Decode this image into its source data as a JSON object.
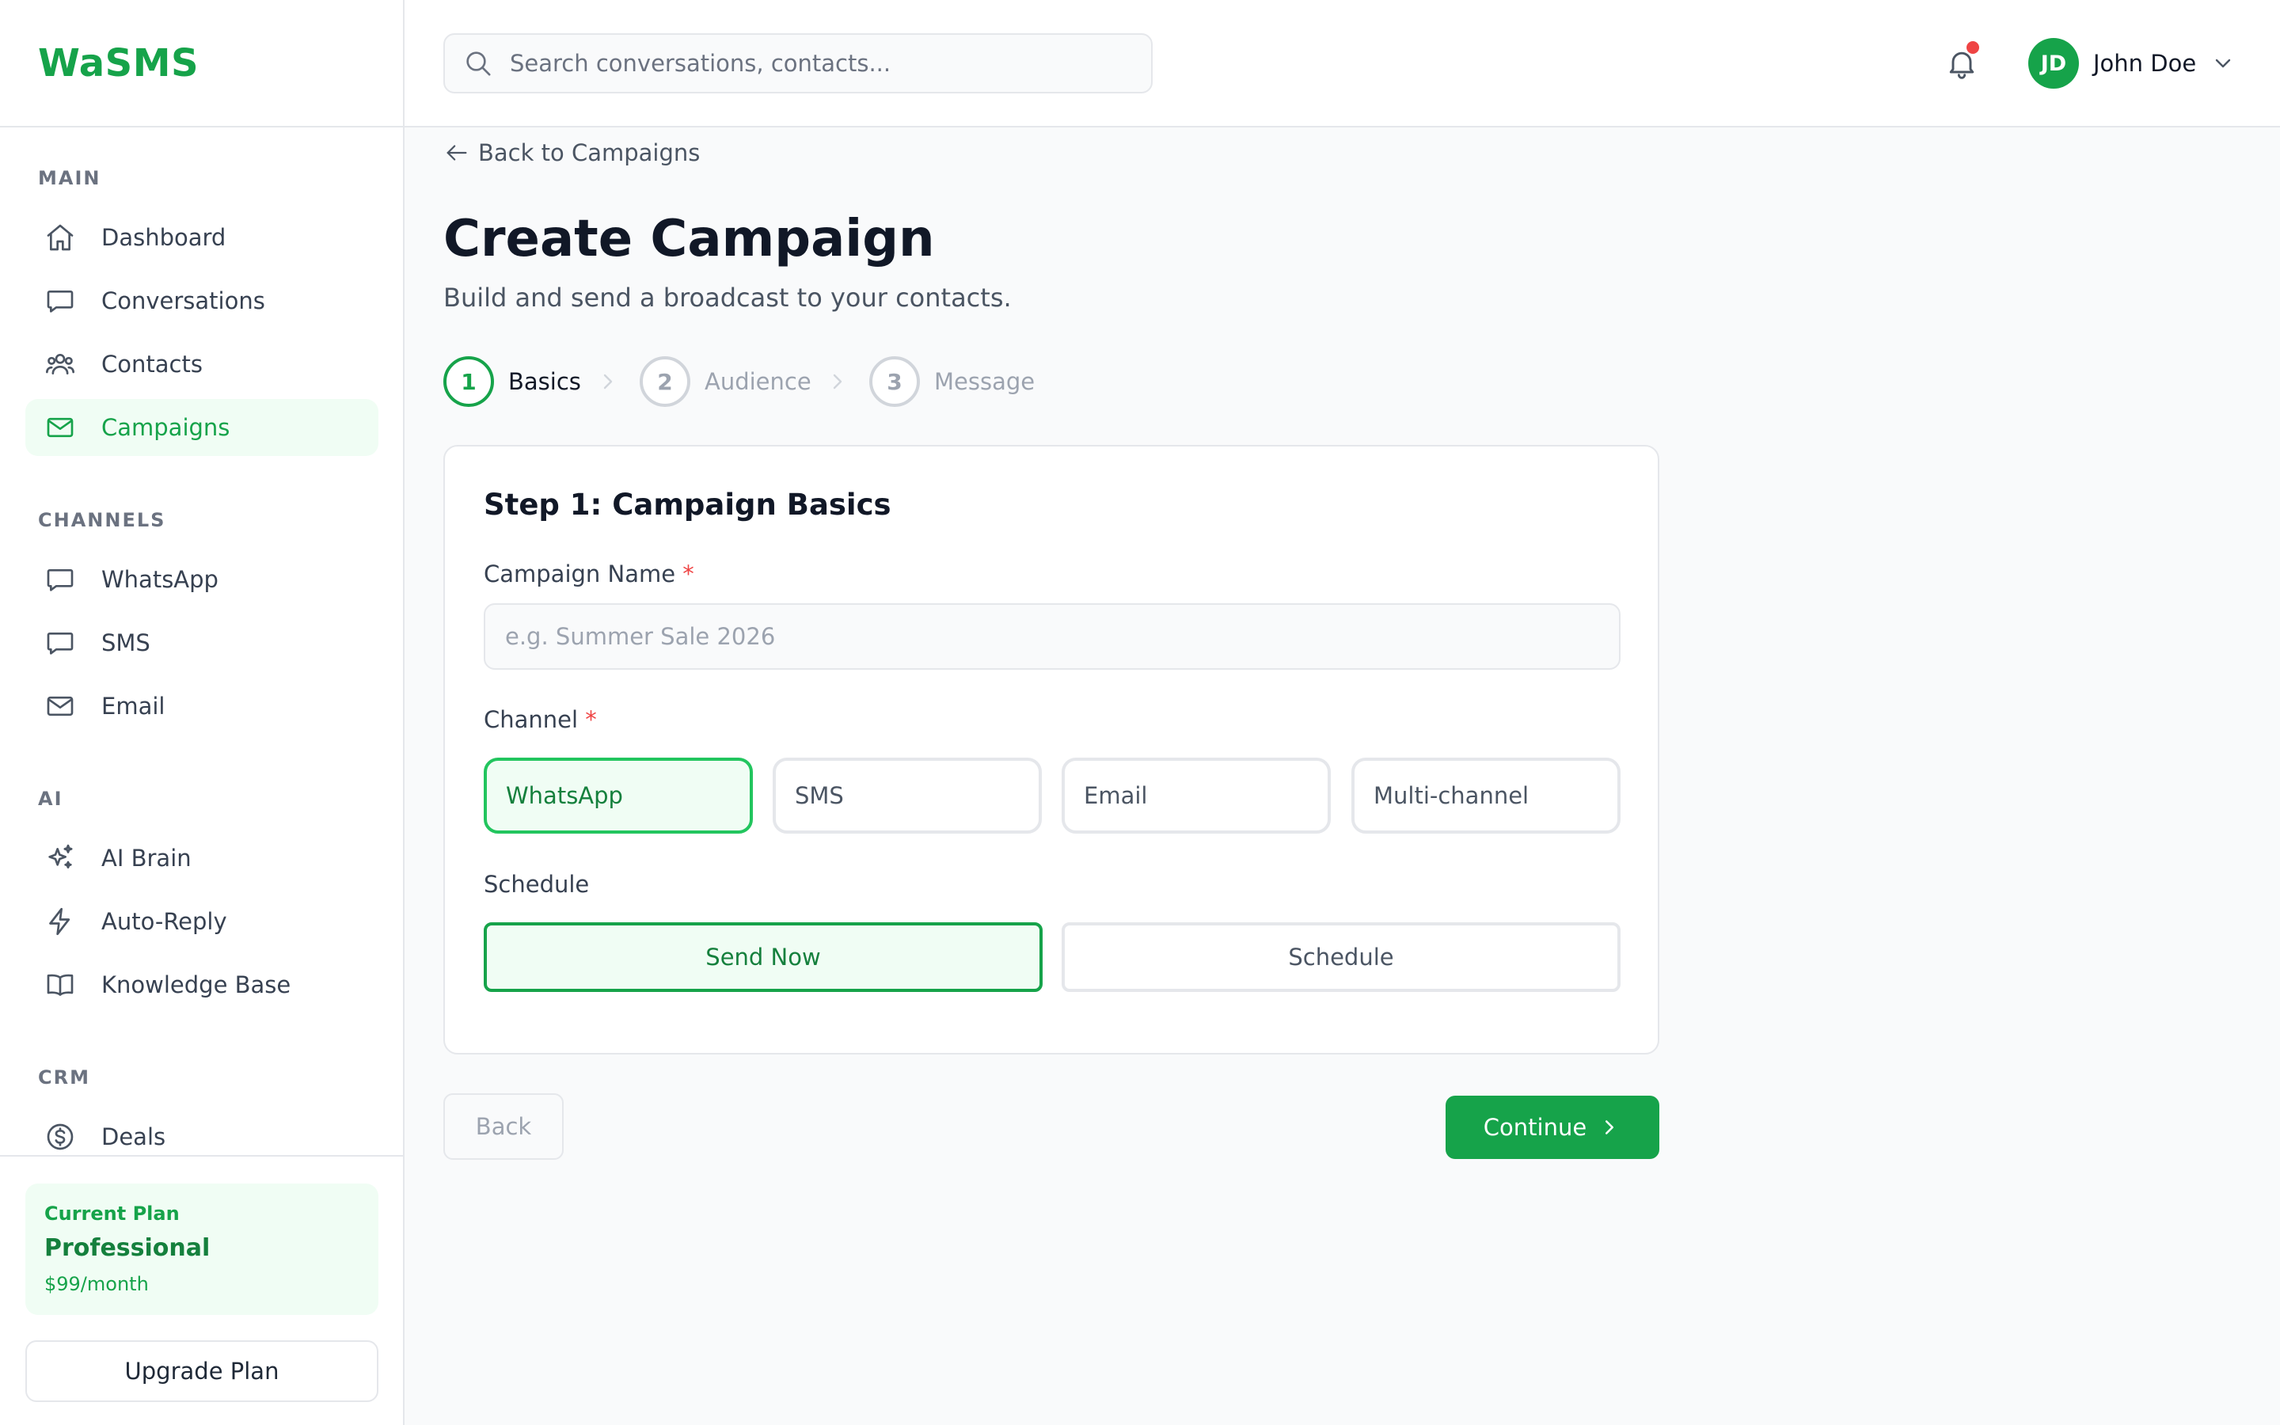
{
  "app": {
    "brand": "WaSMS"
  },
  "colors": {
    "accent": "#16a34a",
    "accent_bg": "#f0fdf4",
    "danger": "#ef4444"
  },
  "sidebar": {
    "sections": [
      {
        "title": "MAIN",
        "items": [
          {
            "label": "Dashboard",
            "icon": "home-icon"
          },
          {
            "label": "Conversations",
            "icon": "chat-bubble-icon"
          },
          {
            "label": "Contacts",
            "icon": "users-icon"
          },
          {
            "label": "Campaigns",
            "icon": "envelope-icon",
            "active": true
          }
        ]
      },
      {
        "title": "CHANNELS",
        "items": [
          {
            "label": "WhatsApp",
            "icon": "chat-bubble-icon"
          },
          {
            "label": "SMS",
            "icon": "chat-bubble-icon"
          },
          {
            "label": "Email",
            "icon": "envelope-icon"
          }
        ]
      },
      {
        "title": "AI",
        "items": [
          {
            "label": "AI Brain",
            "icon": "sparkles-icon"
          },
          {
            "label": "Auto-Reply",
            "icon": "lightning-icon"
          },
          {
            "label": "Knowledge Base",
            "icon": "book-icon"
          }
        ]
      },
      {
        "title": "CRM",
        "items": [
          {
            "label": "Deals",
            "icon": "dollar-circle-icon"
          }
        ]
      }
    ],
    "plan": {
      "label": "Current Plan",
      "name": "Professional",
      "price": "$99/month"
    },
    "upgrade_label": "Upgrade Plan"
  },
  "header": {
    "search_placeholder": "Search conversations, contacts...",
    "notifications_unread": true,
    "user": {
      "initials": "JD",
      "name": "John Doe"
    }
  },
  "main": {
    "back_label": "Back to Campaigns",
    "title": "Create Campaign",
    "subtitle": "Build and send a broadcast to your contacts.",
    "steps": [
      {
        "number": "1",
        "label": "Basics",
        "active": true
      },
      {
        "number": "2",
        "label": "Audience"
      },
      {
        "number": "3",
        "label": "Message"
      }
    ],
    "form": {
      "heading": "Step 1: Campaign Basics",
      "name_label": "Campaign Name",
      "required_mark": "*",
      "name_placeholder": "e.g. Summer Sale 2026",
      "name_value": "",
      "channel_label": "Channel",
      "channels": [
        {
          "label": "WhatsApp",
          "selected": true
        },
        {
          "label": "SMS"
        },
        {
          "label": "Email"
        },
        {
          "label": "Multi-channel"
        }
      ],
      "schedule_label": "Schedule",
      "schedule_options": [
        {
          "label": "Send Now",
          "selected": true
        },
        {
          "label": "Schedule"
        }
      ]
    },
    "back_button": "Back",
    "continue_button": "Continue"
  }
}
